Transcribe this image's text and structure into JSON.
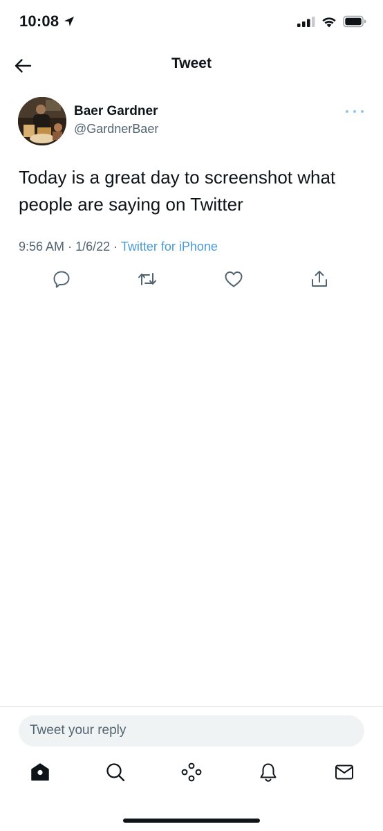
{
  "status_bar": {
    "time": "10:08",
    "location_icon": "location-arrow-icon",
    "signal_icon": "cellular-signal-icon",
    "wifi_icon": "wifi-icon",
    "battery_icon": "battery-icon"
  },
  "header": {
    "back_icon": "arrow-left-icon",
    "title": "Tweet"
  },
  "tweet": {
    "author_name": "Baer Gardner",
    "author_handle": "@GardnerBaer",
    "more_icon": "more-horizontal-icon",
    "text": "Today is a great day to screenshot what people are saying on Twitter",
    "time": "9:56 AM",
    "date": "1/6/22",
    "separator": "·",
    "source": "Twitter for iPhone",
    "actions": [
      {
        "name": "reply",
        "icon": "reply-icon"
      },
      {
        "name": "retweet",
        "icon": "retweet-icon"
      },
      {
        "name": "like",
        "icon": "heart-icon"
      },
      {
        "name": "share",
        "icon": "share-icon"
      }
    ]
  },
  "reply": {
    "placeholder": "Tweet your reply"
  },
  "tabbar": {
    "items": [
      {
        "name": "home",
        "icon": "home-icon"
      },
      {
        "name": "search",
        "icon": "search-icon"
      },
      {
        "name": "spaces",
        "icon": "spaces-icon"
      },
      {
        "name": "notifications",
        "icon": "bell-icon"
      },
      {
        "name": "messages",
        "icon": "mail-icon"
      }
    ]
  },
  "colors": {
    "text_primary": "#0f1419",
    "text_secondary": "#536471",
    "link": "#4a9ad6",
    "reply_bg": "#eff3f4",
    "divider": "#e1e6ea"
  }
}
